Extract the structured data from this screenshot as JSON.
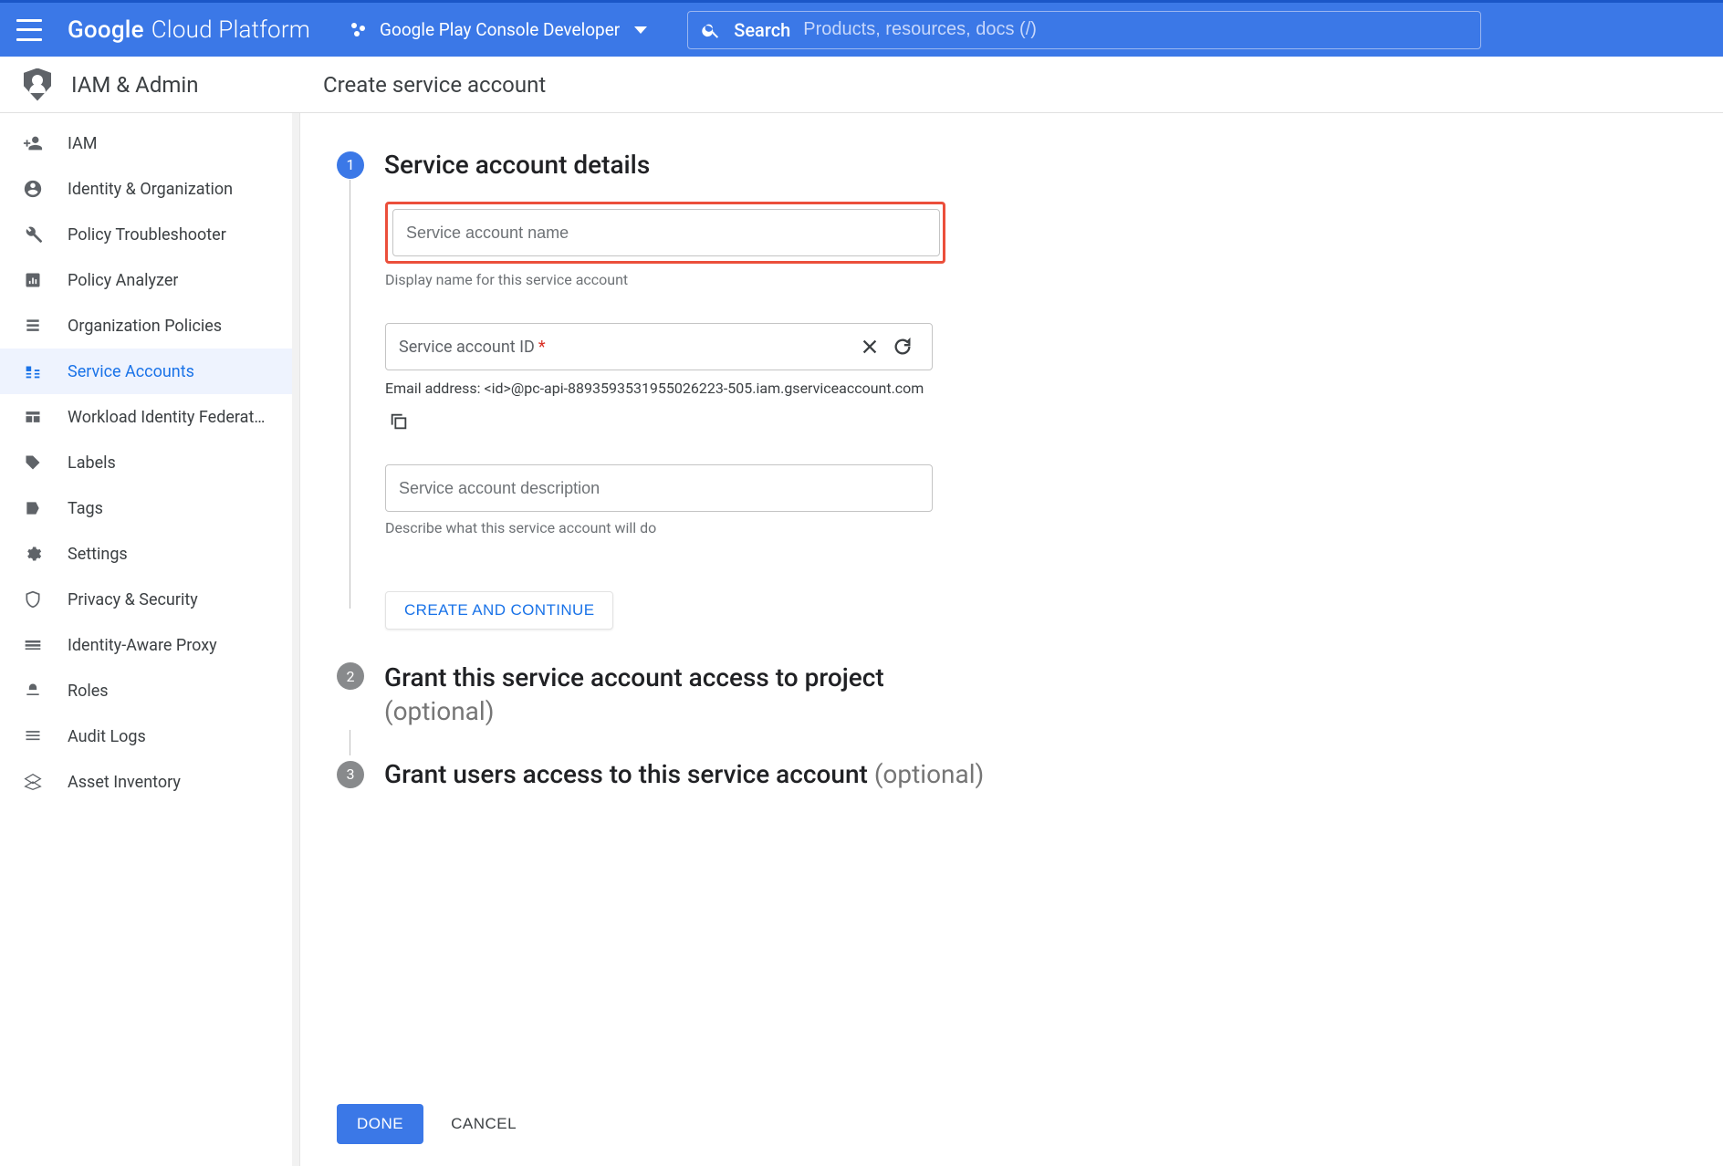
{
  "header": {
    "brand_g": "Google",
    "brand_cp": "Cloud Platform",
    "project_name": "Google Play Console Developer",
    "search_label": "Search",
    "search_placeholder": "Products, resources, docs (/)"
  },
  "section": {
    "title": "IAM & Admin",
    "page_title": "Create service account"
  },
  "sidebar": {
    "items": [
      {
        "label": "IAM"
      },
      {
        "label": "Identity & Organization"
      },
      {
        "label": "Policy Troubleshooter"
      },
      {
        "label": "Policy Analyzer"
      },
      {
        "label": "Organization Policies"
      },
      {
        "label": "Service Accounts"
      },
      {
        "label": "Workload Identity Federati..."
      },
      {
        "label": "Labels"
      },
      {
        "label": "Tags"
      },
      {
        "label": "Settings"
      },
      {
        "label": "Privacy & Security"
      },
      {
        "label": "Identity-Aware Proxy"
      },
      {
        "label": "Roles"
      },
      {
        "label": "Audit Logs"
      },
      {
        "label": "Asset Inventory"
      }
    ]
  },
  "steps": {
    "one_num": "1",
    "one_title": "Service account details",
    "two_num": "2",
    "two_title": "Grant this service account access to project",
    "two_optional": "(optional)",
    "three_num": "3",
    "three_title": "Grant users access to this service account ",
    "three_optional": "(optional)"
  },
  "form": {
    "name_placeholder": "Service account name",
    "name_helper": "Display name for this service account",
    "id_placeholder": "Service account ID",
    "id_required_mark": "*",
    "email_line": "Email address: <id>@pc-api-8893593531955026223-505.iam.gserviceaccount.com",
    "desc_placeholder": "Service account description",
    "desc_helper": "Describe what this service account will do",
    "create_continue": "CREATE AND CONTINUE"
  },
  "actions": {
    "done": "DONE",
    "cancel": "CANCEL"
  }
}
